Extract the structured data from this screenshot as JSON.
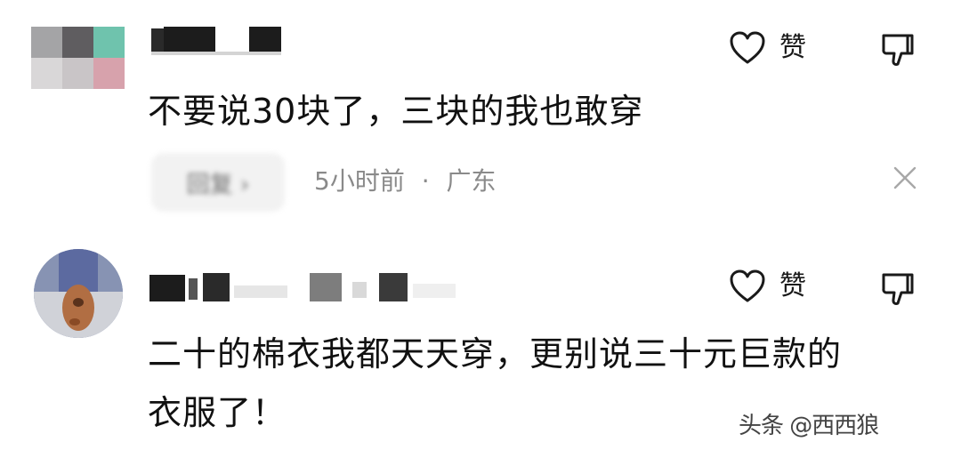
{
  "comments": [
    {
      "text": "不要说30块了，三块的我也敢穿",
      "like_label": "赞",
      "reply_label": "回复 ›",
      "time": "5小时前",
      "separator": "·",
      "location": "广东"
    },
    {
      "text_line1": "二十的棉衣我都天天穿，更别说三十元巨款的",
      "text_line2": "衣服了！",
      "like_label": "赞"
    }
  ],
  "watermark": "头条 @西西狼",
  "icons": {
    "like": "heart-outline-icon",
    "dislike": "thumbs-down-outline-icon",
    "close": "close-icon"
  },
  "colors": {
    "text": "#111111",
    "meta": "#8a8a8a",
    "reply_bg": "#f2f2f2"
  }
}
